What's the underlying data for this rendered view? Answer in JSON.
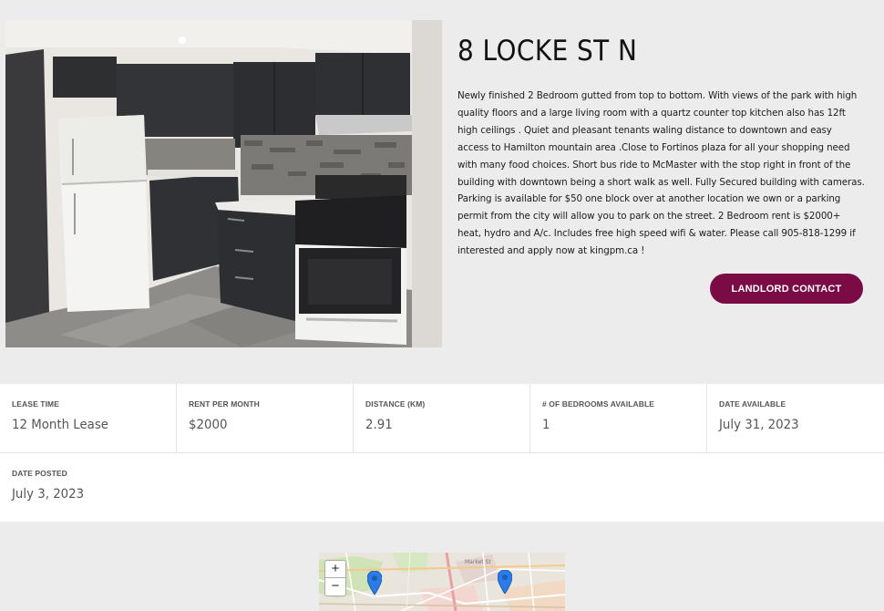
{
  "listing": {
    "title": "8 LOCKE ST N",
    "description": "Newly finished 2 Bedroom gutted from top to bottom. With views of the park with high quality floors and a large living room with a quartz counter top kitchen also has 12ft high ceilings . Quiet and pleasant tenants waling distance to downtown and easy access to Hamilton mountain area .Close to Fortinos plaza for all your shopping need with many food choices. Short bus ride to McMaster with the stop right in front of the building with downtown being a short walk as well. Fully Secured building with cameras. Parking is available for $50 one block over at another location we own or a parking permit from the city will allow you to park on the street. 2 Bedroom rent is $2000+ heat, hydro and A/c. Includes free high speed wifi & water. Please call 905-818-1299 if interested and apply now at kingpm.ca !",
    "contact_button": "LANDLORD CONTACT",
    "accent_color": "#7a0b45"
  },
  "details": [
    {
      "label": "LEASE TIME",
      "value": "12 Month Lease"
    },
    {
      "label": "RENT PER MONTH",
      "value": "$2000"
    },
    {
      "label": "DISTANCE (KM)",
      "value": "2.91"
    },
    {
      "label": "# OF BEDROOMS AVAILABLE",
      "value": "1"
    },
    {
      "label": "DATE AVAILABLE",
      "value": "July 31, 2023"
    },
    {
      "label": "DATE POSTED",
      "value": "July 3, 2023"
    }
  ],
  "map": {
    "zoom_in": "+",
    "zoom_out": "−",
    "street_label": "Market St"
  }
}
